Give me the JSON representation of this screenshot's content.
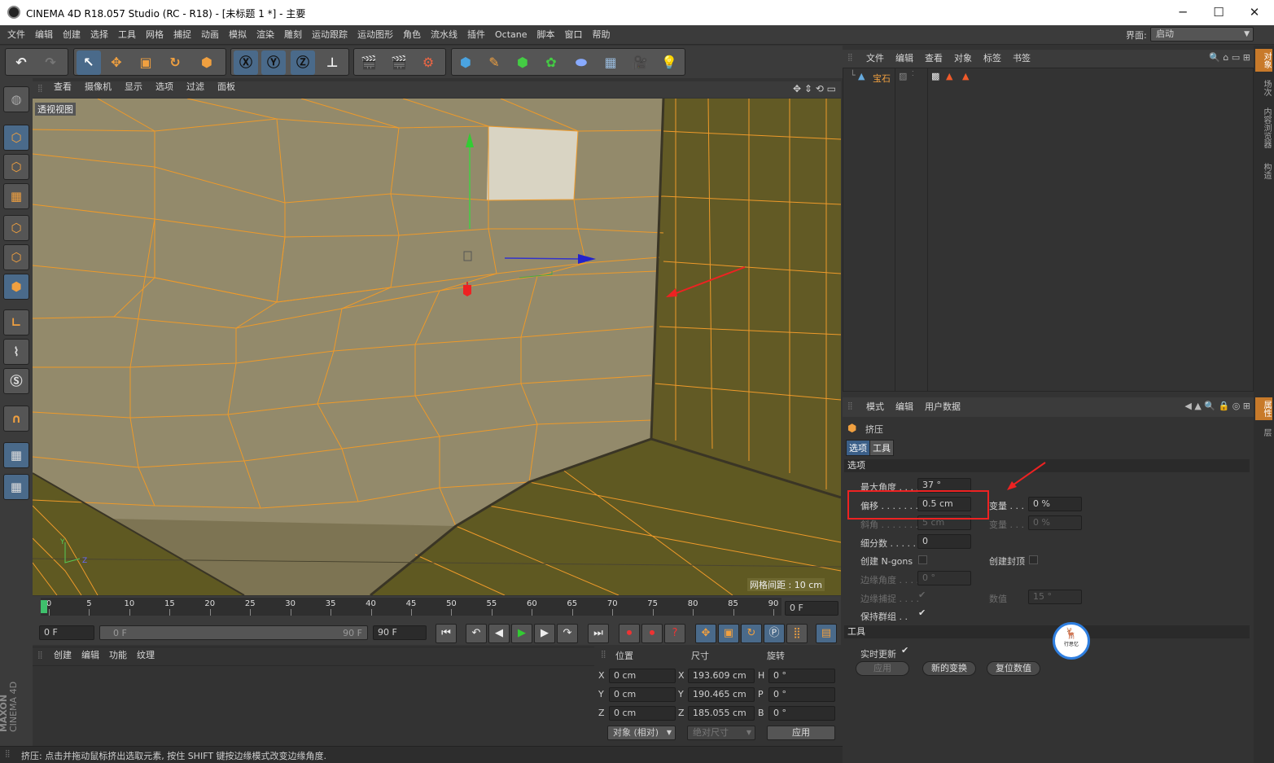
{
  "window": {
    "title": "CINEMA 4D R18.057 Studio (RC - R18) - [未标题 1 *] - 主要",
    "controls": [
      "─",
      "☐",
      "✕"
    ]
  },
  "menu": [
    "文件",
    "编辑",
    "创建",
    "选择",
    "工具",
    "网格",
    "捕捉",
    "动画",
    "模拟",
    "渲染",
    "雕刻",
    "运动跟踪",
    "运动图形",
    "角色",
    "流水线",
    "插件",
    "Octane",
    "脚本",
    "窗口",
    "帮助"
  ],
  "layout": {
    "label": "界面:",
    "value": "启动"
  },
  "viewport": {
    "menu": [
      "查看",
      "摄像机",
      "显示",
      "选项",
      "过滤",
      "面板"
    ],
    "label": "透视视图",
    "grid_info": "网格间距 : 10 cm",
    "axes": [
      "Y",
      "Z"
    ]
  },
  "timeline": {
    "ticks": [
      "0",
      "5",
      "10",
      "15",
      "20",
      "25",
      "30",
      "35",
      "40",
      "45",
      "50",
      "55",
      "60",
      "65",
      "70",
      "75",
      "80",
      "85",
      "90"
    ],
    "current": "0 F"
  },
  "transport": {
    "start": "0 F",
    "range_start": "0 F",
    "range_end": "90 F",
    "end": "90 F"
  },
  "material": {
    "menu": [
      "创建",
      "编辑",
      "功能",
      "纹理"
    ]
  },
  "coords": {
    "headers": [
      "位置",
      "尺寸",
      "旋转"
    ],
    "rows": [
      {
        "axis": "X",
        "pos": "0 cm",
        "size_axis": "X",
        "size": "193.609 cm",
        "rot_axis": "H",
        "rot": "0 °"
      },
      {
        "axis": "Y",
        "pos": "0 cm",
        "size_axis": "Y",
        "size": "190.465 cm",
        "rot_axis": "P",
        "rot": "0 °"
      },
      {
        "axis": "Z",
        "pos": "0 cm",
        "size_axis": "Z",
        "size": "185.055 cm",
        "rot_axis": "B",
        "rot": "0 °"
      }
    ],
    "mode": "对象 (相对)",
    "size_mode": "绝对尺寸",
    "apply": "应用"
  },
  "status": "挤压: 点击并拖动鼠标挤出选取元素, 按住 SHIFT 键按边缘模式改变边缘角度.",
  "logo": {
    "top": "MAXON",
    "bottom": "CINEMA 4D"
  },
  "objects": {
    "menu": [
      "文件",
      "编辑",
      "查看",
      "对象",
      "标签",
      "书签"
    ],
    "items": [
      {
        "name": "宝石"
      }
    ]
  },
  "attributes": {
    "menu": [
      "模式",
      "编辑",
      "用户数据"
    ],
    "tool_name": "挤压",
    "tabs": [
      "选项",
      "工具"
    ],
    "section_options": "选项",
    "max_angle": {
      "label": "最大角度 . . . .",
      "value": "37 °"
    },
    "offset": {
      "label": "偏移 . . . . . . .",
      "value": "0.5 cm"
    },
    "variance1": {
      "label": "变量 . . .",
      "value": "0 %"
    },
    "bevel": {
      "label": "斜角 . . . . . . .",
      "value": "5 cm"
    },
    "variance2": {
      "label": "变量 . . .",
      "value": "0 %"
    },
    "subdiv": {
      "label": "细分数 . . . . .",
      "value": "0"
    },
    "ngons": "创建 N-gons",
    "caps": "创建封顶",
    "edge_angle": {
      "label": "边缘角度 . . . .",
      "value": "0 °"
    },
    "edge_snap": "边缘捕捉 . . . .",
    "snap_value": {
      "label": "数值",
      "value": "15 °"
    },
    "keep_groups": "保持群组 . .",
    "section_tool": "工具",
    "realtime": "实时更新",
    "buttons": [
      "应用",
      "新的变换",
      "复位数值"
    ]
  },
  "right_tabs": [
    "对象",
    "场次",
    "内容浏览器",
    "构造"
  ],
  "right_tabs2": [
    "属性",
    "层"
  ],
  "watermark": "行思忆"
}
